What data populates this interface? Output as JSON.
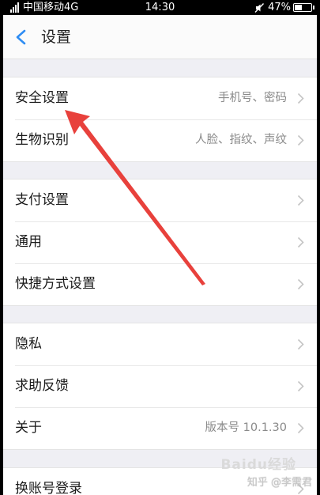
{
  "status_bar": {
    "carrier": "中国移动4G",
    "time": "14:30",
    "battery": "47%",
    "battery_level": 0.47,
    "icons": [
      "signal-icon",
      "mute-icon",
      "battery-icon"
    ]
  },
  "nav": {
    "back_icon": "chevron-left-icon",
    "title": "设置"
  },
  "groups": [
    {
      "rows": [
        {
          "label": "安全设置",
          "value": "手机号、密码"
        },
        {
          "label": "生物识别",
          "value": "人脸、指纹、声纹"
        }
      ]
    },
    {
      "rows": [
        {
          "label": "支付设置",
          "value": ""
        },
        {
          "label": "通用",
          "value": ""
        },
        {
          "label": "快捷方式设置",
          "value": ""
        }
      ]
    },
    {
      "rows": [
        {
          "label": "隐私",
          "value": ""
        },
        {
          "label": "求助反馈",
          "value": ""
        },
        {
          "label": "关于",
          "value": "版本号 10.1.30"
        }
      ]
    },
    {
      "rows": [
        {
          "label": "换账号登录",
          "value": ""
        }
      ]
    }
  ],
  "annotation": {
    "arrow_color": "#e8413c"
  },
  "watermark": {
    "logo": "Baidu经验",
    "text": "知乎 @李需君"
  },
  "colors": {
    "accent": "#2f8df3",
    "background": "#efeff4",
    "row": "#ffffff"
  }
}
